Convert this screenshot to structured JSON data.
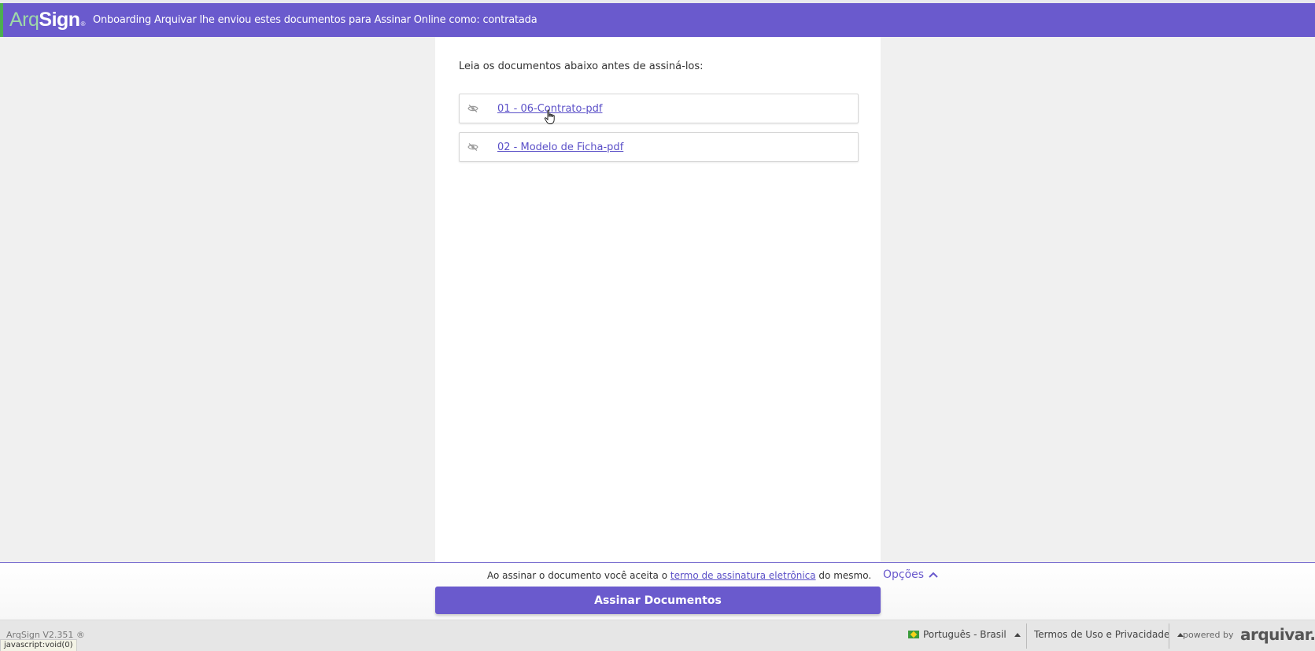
{
  "header": {
    "logo_arq": "Arq",
    "logo_sign": "Sign",
    "logo_reg": "®",
    "title": "Onboarding Arquivar lhe enviou estes documentos para Assinar Online como: contratada"
  },
  "main": {
    "intro": "Leia os documentos abaixo antes de assiná-los:",
    "documents": [
      {
        "label": "01 - 06-Contrato-pdf"
      },
      {
        "label": "02 - Modelo de Ficha-pdf"
      }
    ]
  },
  "footer": {
    "accept_prefix": "Ao assinar o documento você aceita o ",
    "accept_link": "termo de assinatura eletrônica",
    "accept_suffix": " do mesmo.",
    "options_label": "Opções",
    "sign_button": "Assinar Documentos"
  },
  "bottom_bar": {
    "version": "ArqSign V2.351 ®",
    "status_tip": "javascript:void(0)",
    "language": "Português - Brasil",
    "terms": "Termos de Uso e Privacidade",
    "powered_by": "powered by",
    "brand": "arquivar."
  },
  "colors": {
    "accent": "#6a5acd",
    "link": "#5b50c8",
    "logo_green": "#9ed9a8"
  },
  "icons": {
    "document_visibility": "eye-slash-icon",
    "options_toggle": "chevron-up-icon",
    "language_toggle": "caret-up-icon"
  }
}
